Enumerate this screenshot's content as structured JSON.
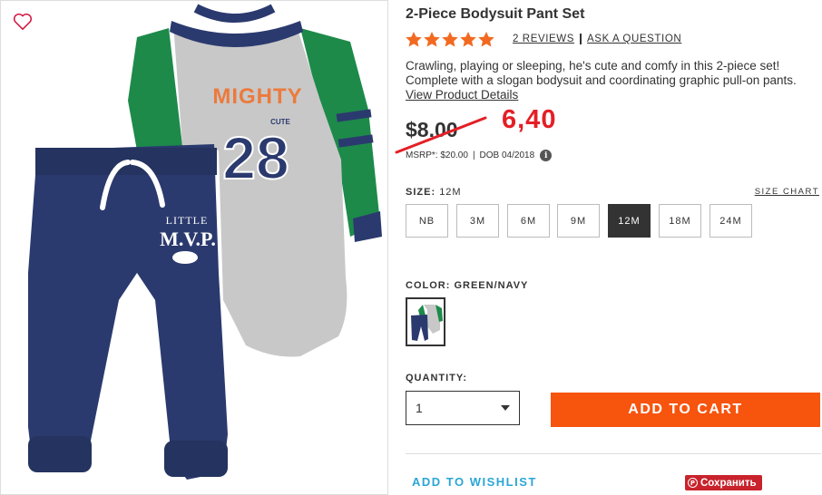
{
  "product": {
    "title": "2-Piece Bodysuit Pant Set",
    "rating_stars": 5,
    "reviews_label": "2 REVIEWS",
    "ask_label": "ASK A QUESTION",
    "description": "Crawling, playing or sleeping, he's cute and comfy in this 2-piece set! Complete with a slogan bodysuit and coordinating graphic pull-on pants.",
    "view_details_label": "View Product Details",
    "price_old": "$8.00",
    "price_new_annotation": "6,40",
    "msrp": "MSRP*: $20.00",
    "dob": "DOB 04/2018",
    "info_icon_glyph": "i"
  },
  "image": {
    "bodysuit_text_top": "MIGHTY",
    "bodysuit_text_small": "CUTE",
    "bodysuit_number": "28",
    "pants_text_top": "LITTLE",
    "pants_text_main": "M.V.P.",
    "colors": {
      "navy": "#2b3a6e",
      "green": "#1d8a4a",
      "gray": "#c8c8c8",
      "orange": "#ec7a3c"
    }
  },
  "size": {
    "label": "SIZE:",
    "selected": "12M",
    "chart_label": "SIZE CHART",
    "options": [
      "NB",
      "3M",
      "6M",
      "9M",
      "12M",
      "18M",
      "24M"
    ]
  },
  "color": {
    "label": "COLOR:",
    "value": "GREEN/NAVY"
  },
  "quantity": {
    "label": "QUANTITY:",
    "value": "1"
  },
  "actions": {
    "add_to_cart": "ADD TO CART",
    "add_to_wishlist": "ADD TO WISHLIST",
    "save_label": "Сохранить"
  },
  "theme": {
    "accent_orange": "#f7540e",
    "annotation_red": "#e41f26",
    "link_blue": "#2aa6d6",
    "pinterest_red": "#c8232c",
    "star_orange": "#f26a21"
  }
}
